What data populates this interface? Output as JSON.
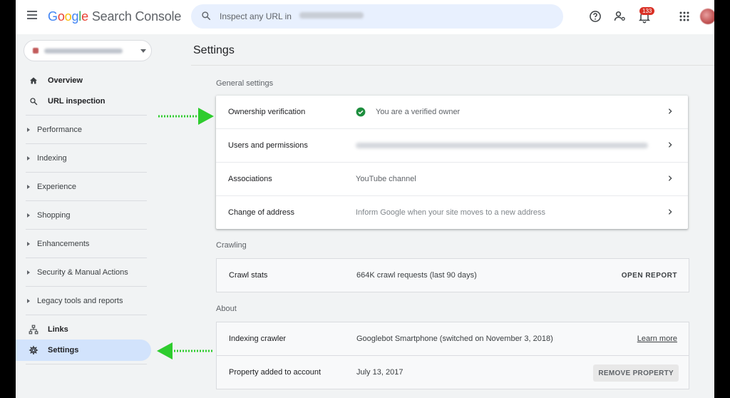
{
  "header": {
    "logo_google": "Google",
    "logo_product": "Search Console",
    "search_placeholder": "Inspect any URL in",
    "notification_count": "133"
  },
  "sidebar": {
    "primary": [
      {
        "label": "Overview",
        "icon": "home-icon"
      },
      {
        "label": "URL inspection",
        "icon": "search-icon"
      }
    ],
    "sections": [
      {
        "label": "Performance"
      },
      {
        "label": "Indexing"
      },
      {
        "label": "Experience"
      },
      {
        "label": "Shopping"
      },
      {
        "label": "Enhancements"
      },
      {
        "label": "Security & Manual Actions"
      },
      {
        "label": "Legacy tools and reports"
      }
    ],
    "footer": [
      {
        "label": "Links",
        "icon": "links-icon"
      },
      {
        "label": "Settings",
        "icon": "gear-icon",
        "active": true
      }
    ]
  },
  "main": {
    "title": "Settings",
    "general": {
      "label": "General settings",
      "rows": [
        {
          "name": "Ownership verification",
          "value": "You are a verified owner"
        },
        {
          "name": "Users and permissions",
          "value": ""
        },
        {
          "name": "Associations",
          "value": "YouTube channel"
        },
        {
          "name": "Change of address",
          "value": "Inform Google when your site moves to a new address"
        }
      ]
    },
    "crawling": {
      "label": "Crawling",
      "rows": [
        {
          "name": "Crawl stats",
          "value": "664K crawl requests (last 90 days)",
          "action": "OPEN REPORT"
        }
      ]
    },
    "about": {
      "label": "About",
      "rows": [
        {
          "name": "Indexing crawler",
          "value": "Googlebot Smartphone (switched on November 3, 2018)",
          "action": "Learn more"
        },
        {
          "name": "Property added to account",
          "value": "July 13, 2017",
          "action": "REMOVE PROPERTY"
        }
      ]
    }
  },
  "colors": {
    "accent": "#1a73e8",
    "active_nav": "#d2e3fc",
    "verified_green": "#1e8e3e",
    "arrow_green": "#2ecc2e",
    "search_bg": "#e8f0fe"
  }
}
